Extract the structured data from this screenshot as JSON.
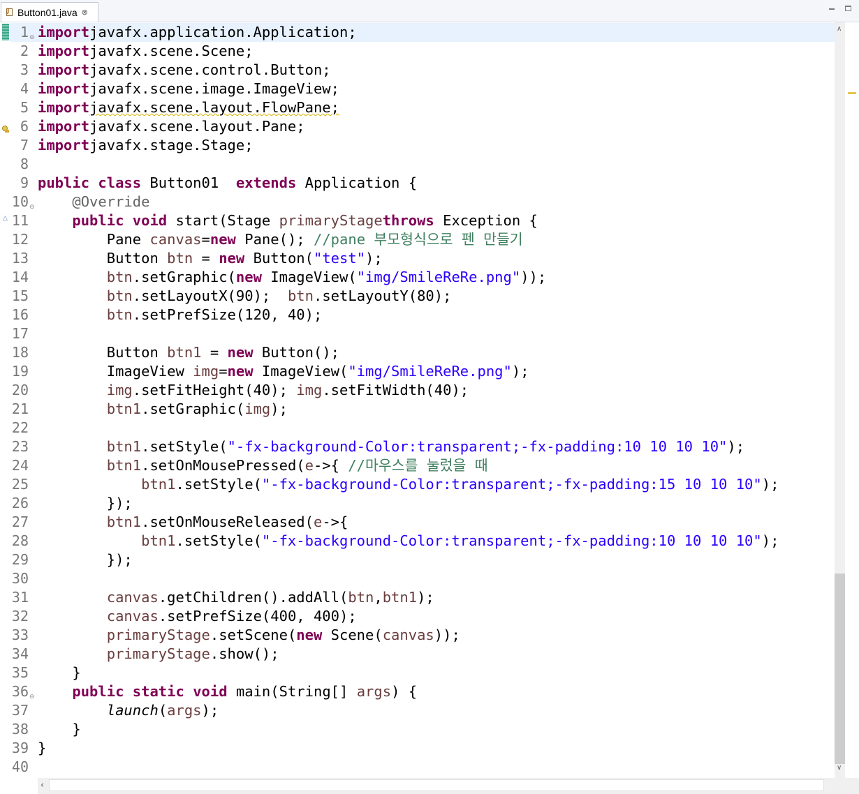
{
  "tab": {
    "label": "Button01.java",
    "close_glyph": "⊗"
  },
  "window_controls": {
    "minimize": "minimize-icon",
    "maximize": "maximize-icon"
  },
  "colors": {
    "keyword": "#7f0055",
    "string": "#2a00ff",
    "comment": "#3f7f5f",
    "annotation": "#646464",
    "variable": "#6a3e3e",
    "current_line": "#e8f2fe"
  },
  "line_numbers": [
    "1",
    "2",
    "3",
    "4",
    "5",
    "6",
    "7",
    "8",
    "9",
    "10",
    "11",
    "12",
    "13",
    "14",
    "15",
    "16",
    "17",
    "18",
    "19",
    "20",
    "21",
    "22",
    "23",
    "24",
    "25",
    "26",
    "27",
    "28",
    "29",
    "30",
    "31",
    "32",
    "33",
    "34",
    "35",
    "36",
    "37",
    "38",
    "39",
    "40"
  ],
  "code_lines": [
    [
      [
        "kw",
        "import"
      ],
      [
        "",
        "javafx.application.Application;"
      ]
    ],
    [
      [
        "kw",
        "import"
      ],
      [
        "",
        "javafx.scene.Scene;"
      ]
    ],
    [
      [
        "kw",
        "import"
      ],
      [
        "",
        "javafx.scene.control.Button;"
      ]
    ],
    [
      [
        "kw",
        "import"
      ],
      [
        "",
        "javafx.scene.image.ImageView;"
      ]
    ],
    [
      [
        "kw",
        "import"
      ],
      [
        "squig",
        "javafx.scene.layout.FlowPane;"
      ]
    ],
    [
      [
        "kw",
        "import"
      ],
      [
        "",
        "javafx.scene.layout.Pane;"
      ]
    ],
    [
      [
        "kw",
        "import"
      ],
      [
        "",
        "javafx.stage.Stage;"
      ]
    ],
    [],
    [
      [
        "kw",
        "public"
      ],
      [
        "",
        " "
      ],
      [
        "kw",
        "class"
      ],
      [
        "",
        " Button01  "
      ],
      [
        "kw",
        "extends"
      ],
      [
        "",
        " Application {"
      ]
    ],
    [
      [
        "",
        "    "
      ],
      [
        "an",
        "@Override"
      ]
    ],
    [
      [
        "",
        "    "
      ],
      [
        "kw",
        "public"
      ],
      [
        "",
        " "
      ],
      [
        "kw",
        "void"
      ],
      [
        "",
        " start(Stage "
      ],
      [
        "var",
        "primaryStage"
      ],
      [
        ") "
      ],
      [
        "kw",
        "throws"
      ],
      [
        "",
        " Exception {"
      ]
    ],
    [
      [
        "",
        "        Pane "
      ],
      [
        "var",
        "canvas"
      ],
      [
        "",
        "="
      ],
      [
        "kw",
        "new"
      ],
      [
        "",
        " Pane(); "
      ],
      [
        "cm",
        "//pane 부모형식으로 펜 만들기"
      ]
    ],
    [
      [
        "",
        "        Button "
      ],
      [
        "var",
        "btn"
      ],
      [
        "",
        " = "
      ],
      [
        "kw",
        "new"
      ],
      [
        "",
        " Button("
      ],
      [
        "str",
        "\"test\""
      ],
      [
        "",
        ");"
      ]
    ],
    [
      [
        "",
        "        "
      ],
      [
        "var",
        "btn"
      ],
      [
        "",
        ".setGraphic("
      ],
      [
        "kw",
        "new"
      ],
      [
        "",
        " ImageView("
      ],
      [
        "str",
        "\"img/SmileReRe.png\""
      ],
      [
        "",
        "));"
      ]
    ],
    [
      [
        "",
        "        "
      ],
      [
        "var",
        "btn"
      ],
      [
        "",
        ".setLayoutX(90);  "
      ],
      [
        "var",
        "btn"
      ],
      [
        "",
        ".setLayoutY(80);"
      ]
    ],
    [
      [
        "",
        "        "
      ],
      [
        "var",
        "btn"
      ],
      [
        "",
        ".setPrefSize(120, 40);"
      ]
    ],
    [],
    [
      [
        "",
        "        Button "
      ],
      [
        "var",
        "btn1"
      ],
      [
        "",
        " = "
      ],
      [
        "kw",
        "new"
      ],
      [
        "",
        " Button();"
      ]
    ],
    [
      [
        "",
        "        ImageView "
      ],
      [
        "var",
        "img"
      ],
      [
        "",
        "="
      ],
      [
        "kw",
        "new"
      ],
      [
        "",
        " ImageView("
      ],
      [
        "str",
        "\"img/SmileReRe.png\""
      ],
      [
        "",
        ");"
      ]
    ],
    [
      [
        "",
        "        "
      ],
      [
        "var",
        "img"
      ],
      [
        "",
        ".setFitHeight(40); "
      ],
      [
        "var",
        "img"
      ],
      [
        "",
        ".setFitWidth(40);"
      ]
    ],
    [
      [
        "",
        "        "
      ],
      [
        "var",
        "btn1"
      ],
      [
        "",
        ".setGraphic("
      ],
      [
        "var",
        "img"
      ],
      [
        "",
        ");"
      ]
    ],
    [],
    [
      [
        "",
        "        "
      ],
      [
        "var",
        "btn1"
      ],
      [
        "",
        ".setStyle("
      ],
      [
        "str",
        "\"-fx-background-Color:transparent;-fx-padding:10 10 10 10\""
      ],
      [
        "",
        ");"
      ]
    ],
    [
      [
        "",
        "        "
      ],
      [
        "var",
        "btn1"
      ],
      [
        "",
        ".setOnMousePressed("
      ],
      [
        "var",
        "e"
      ],
      [
        "",
        "->{ "
      ],
      [
        "cm",
        "//마우스를 눌렀을 때"
      ]
    ],
    [
      [
        "",
        "            "
      ],
      [
        "var",
        "btn1"
      ],
      [
        "",
        ".setStyle("
      ],
      [
        "str",
        "\"-fx-background-Color:transparent;-fx-padding:15 10 10 10\""
      ],
      [
        "",
        ");"
      ]
    ],
    [
      [
        "",
        "        });"
      ]
    ],
    [
      [
        "",
        "        "
      ],
      [
        "var",
        "btn1"
      ],
      [
        "",
        ".setOnMouseReleased("
      ],
      [
        "var",
        "e"
      ],
      [
        "",
        "->{"
      ]
    ],
    [
      [
        "",
        "            "
      ],
      [
        "var",
        "btn1"
      ],
      [
        "",
        ".setStyle("
      ],
      [
        "str",
        "\"-fx-background-Color:transparent;-fx-padding:10 10 10 10\""
      ],
      [
        "",
        ");"
      ]
    ],
    [
      [
        "",
        "        });"
      ]
    ],
    [],
    [
      [
        "",
        "        "
      ],
      [
        "var",
        "canvas"
      ],
      [
        "",
        ".getChildren().addAll("
      ],
      [
        "var",
        "btn"
      ],
      [
        "",
        ","
      ],
      [
        "var",
        "btn1"
      ],
      [
        "",
        ");"
      ]
    ],
    [
      [
        "",
        "        "
      ],
      [
        "var",
        "canvas"
      ],
      [
        "",
        ".setPrefSize(400, 400);"
      ]
    ],
    [
      [
        "",
        "        "
      ],
      [
        "var",
        "primaryStage"
      ],
      [
        "",
        ".setScene("
      ],
      [
        "kw",
        "new"
      ],
      [
        "",
        " Scene("
      ],
      [
        "var",
        "canvas"
      ],
      [
        "",
        "));"
      ]
    ],
    [
      [
        "",
        "        "
      ],
      [
        "var",
        "primaryStage"
      ],
      [
        "",
        ".show();"
      ]
    ],
    [
      [
        "",
        "    }"
      ]
    ],
    [
      [
        "",
        "    "
      ],
      [
        "kw",
        "public"
      ],
      [
        "",
        " "
      ],
      [
        "kw",
        "static"
      ],
      [
        "",
        " "
      ],
      [
        "kw",
        "void"
      ],
      [
        "",
        " main(String[] "
      ],
      [
        "var",
        "args"
      ],
      [
        "",
        ") {"
      ]
    ],
    [
      [
        "",
        "        "
      ],
      [
        "it",
        "launch"
      ],
      [
        "",
        "("
      ],
      [
        "var",
        "args"
      ],
      [
        "",
        ");"
      ]
    ],
    [
      [
        "",
        "    }"
      ]
    ],
    [
      [
        "",
        "}"
      ]
    ],
    []
  ],
  "fold_lines": [
    1,
    10,
    36
  ],
  "scroll": {
    "up_glyph": "∧",
    "down_glyph": "∨",
    "left_glyph": "‹"
  }
}
